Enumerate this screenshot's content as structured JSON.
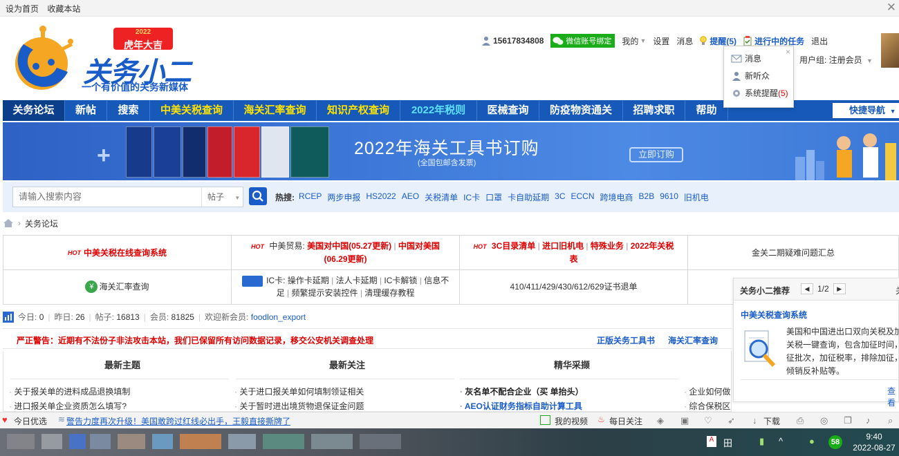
{
  "topbar": {
    "set_home": "设为首页",
    "bookmark": "收藏本站",
    "close_glyph": "✕"
  },
  "logo": {
    "badge_year": "2022",
    "badge_text": "虎年大吉",
    "title": "关务小二",
    "slogan": "一个有价值的关务新媒体"
  },
  "user": {
    "phone": "15617834808",
    "wechat_bind": "微信账号绑定",
    "mine": "我的",
    "settings": "设置",
    "messages": "消息",
    "reminders": "提醒(5)",
    "tasks": "进行中的任务",
    "logout": "退出",
    "usergroup": "用户组: 注册会员"
  },
  "popup": {
    "close": "×",
    "messages": "消息",
    "new_listeners": "新听众",
    "system_reminder": "系统提醒",
    "system_reminder_count": "(5)"
  },
  "nav": {
    "items": [
      "关务论坛",
      "新帖",
      "搜索",
      "中美关税查询",
      "海关汇率查询",
      "知识产权查询",
      "2022年税则",
      "医械查询",
      "防疫物资通关",
      "招聘求职",
      "帮助"
    ],
    "quick_nav": "快捷导航"
  },
  "banner": {
    "headline": "2022年海关工具书订购",
    "sub": "(全国包邮含发票)",
    "cta": "立即订购"
  },
  "search": {
    "placeholder": "请输入搜索内容",
    "scope": "帖子",
    "hot_label": "热搜:",
    "hot_keywords": [
      "RCEP",
      "两步申报",
      "HS2022",
      "AEO",
      "关税清单",
      "IC卡",
      "口罩",
      "卡自助延期",
      "3C",
      "ECCN",
      "跨境电商",
      "B2B",
      "9610",
      "旧机电"
    ]
  },
  "breadcrumb": {
    "current": "关务论坛"
  },
  "quicklinks": {
    "r1c1": "中美关税在线查询系统",
    "r1c2_prefix": "中美贸易:",
    "r1c2_a": "美国对中国(05.27更新)",
    "r1c2_b": "中国对美国(06.29更新)",
    "r1c3_a": "3C目录清单",
    "r1c3_b": "进口旧机电",
    "r1c3_c": "特殊业务",
    "r1c3_d": "2022年关税表",
    "r1c4": "金关二期疑难问题汇总",
    "r2c1": "海关汇率查询",
    "r2c2_prefix": "IC卡:",
    "r2c2_a": "操作卡延期",
    "r2c2_b": "法人卡延期",
    "r2c2_c": "IC卡解锁",
    "r2c2_d": "信息不足",
    "r2c2_e": "频繁提示安装控件",
    "r2c2_f": "清理缓存教程",
    "r2c3": "410/411/429/430/612/629证书退单",
    "hot_tag": "HOT"
  },
  "stats": {
    "today_label": "今日:",
    "today": "0",
    "yesterday_label": "昨日:",
    "yesterday": "26",
    "posts_label": "帖子:",
    "posts": "16813",
    "members_label": "会员:",
    "members": "81825",
    "welcome_label": "欢迎新会员:",
    "new_member": "foodlon_export"
  },
  "warning": {
    "text": "严正警告：近期有不法份子非法攻击本站，我们已保留所有访问数据记录，移交公安机关调查处理",
    "link1": "正版关务工具书",
    "link2": "海关汇率查询"
  },
  "columns": {
    "latest_topics": "最新主题",
    "latest_follow": "最新关注",
    "featured": "精华采撷",
    "topics": [
      "关于报关单的进料成品退换填制",
      "进口报关单企业资质怎么填写?"
    ],
    "follow": [
      "关于进口报关单如何填制领证相关",
      "关于暂时进出境货物退保证金问题"
    ],
    "featured_items": [
      "灰名单不配合企业（买 单抬头）",
      "AEO认证财务指标自助计算工具"
    ],
    "extra": [
      "企业如何做",
      "综合保税区"
    ]
  },
  "recommend": {
    "title": "关务小二推荐",
    "page": "1/2",
    "more": "关",
    "name": "中美关税查询系统",
    "desc_lines": [
      "美国和中国进出口双向关税及加",
      "关税一键查询，包含加征时间，",
      "征批次，加征税率，排除加征，",
      "倾销反补贴等。"
    ],
    "view": "查看"
  },
  "bottombar": {
    "today_pick": "今日优选",
    "news": "警告力度再次升级！美国敢跨过红线必出手，王毅直接撕牌了",
    "my_video": "我的视频",
    "daily_follow": "每日关注",
    "download": "下载"
  },
  "taskbar": {
    "badge": "58",
    "time": "9:40",
    "date": "2022-08-27"
  },
  "colors": {
    "brand_blue": "#1a5cc7",
    "nav_blue": "#1659b8",
    "alert_red": "#dd0000",
    "highlight_yellow": "#ffe300"
  }
}
